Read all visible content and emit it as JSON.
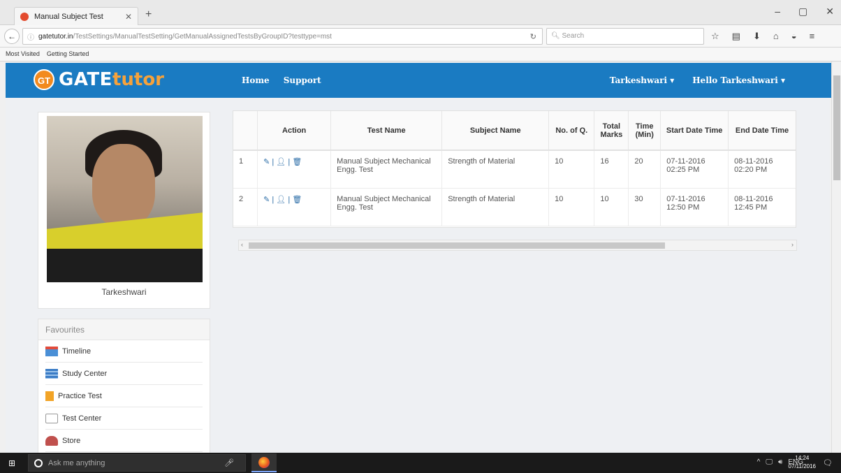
{
  "browser": {
    "tab_title": "Manual Subject Test",
    "url_host": "gatetutor.in",
    "url_path": "/TestSettings/ManualTestSetting/GetManualAssignedTestsByGroupID?testtype=mst",
    "search_placeholder": "Search",
    "bookmarks": [
      "Most Visited",
      "Getting Started"
    ]
  },
  "site": {
    "logo_badge": "GT",
    "logo_gate": "GATE",
    "logo_tutor": "tutor",
    "nav": [
      "Home",
      "Support"
    ],
    "user_dropdown": "Tarkeshwari ▾",
    "hello_dropdown": "Hello Tarkeshwari ▾"
  },
  "profile": {
    "name": "Tarkeshwari"
  },
  "favourites": {
    "title": "Favourites",
    "items": [
      "Timeline",
      "Study Center",
      "Practice Test",
      "Test Center",
      "Store"
    ]
  },
  "table": {
    "headers": [
      "",
      "Action",
      "Test Name",
      "Subject Name",
      "No. of Q.",
      "Total Marks",
      "Time (Min)",
      "Start Date Time",
      "End Date Time"
    ],
    "rows": [
      {
        "num": "1",
        "action": "✎ | 👤 | 🗑",
        "test_name": "Manual Subject Mechanical Engg. Test",
        "subject": "Strength of Material",
        "noq": "10",
        "marks": "16",
        "time": "20",
        "start": "07-11-2016 02:25 PM",
        "end": "08-11-2016 02:20 PM"
      },
      {
        "num": "2",
        "action": "✎ | 👤 | 🗑",
        "test_name": "Manual Subject Mechanical Engg. Test",
        "subject": "Strength of Material",
        "noq": "10",
        "marks": "10",
        "time": "30",
        "start": "07-11-2016 12:50 PM",
        "end": "08-11-2016 12:45 PM"
      }
    ]
  },
  "taskbar": {
    "search_placeholder": "Ask me anything",
    "lang": "ENG",
    "time": "14:24",
    "date": "07/11/2016"
  }
}
